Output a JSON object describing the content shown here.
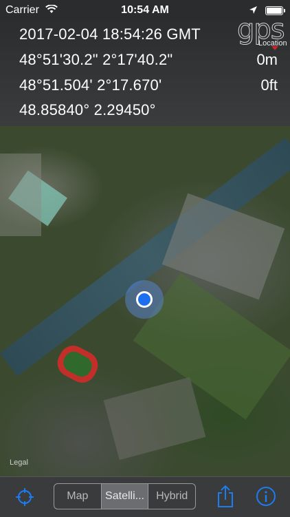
{
  "status_bar": {
    "carrier": "Carrier",
    "time": "10:54 AM",
    "icons": [
      "wifi-icon",
      "location-arrow-icon",
      "battery-icon"
    ]
  },
  "info": {
    "datetime": "2017-02-04   18:54:26 GMT",
    "dms": "48°51'30.2\" 2°17'40.2\"",
    "dm": "48°51.504' 2°17.670'",
    "decimal": "48.85840° 2.29450°",
    "altitude": "0m",
    "accuracy": "0ft",
    "logo_text": "gps",
    "logo_sub": "Location"
  },
  "map": {
    "attribution": "Legal"
  },
  "toolbar": {
    "segments": [
      "Map",
      "Satelli...",
      "Hybrid"
    ],
    "selected": "Satelli...",
    "accent": "#1d7cf2"
  }
}
